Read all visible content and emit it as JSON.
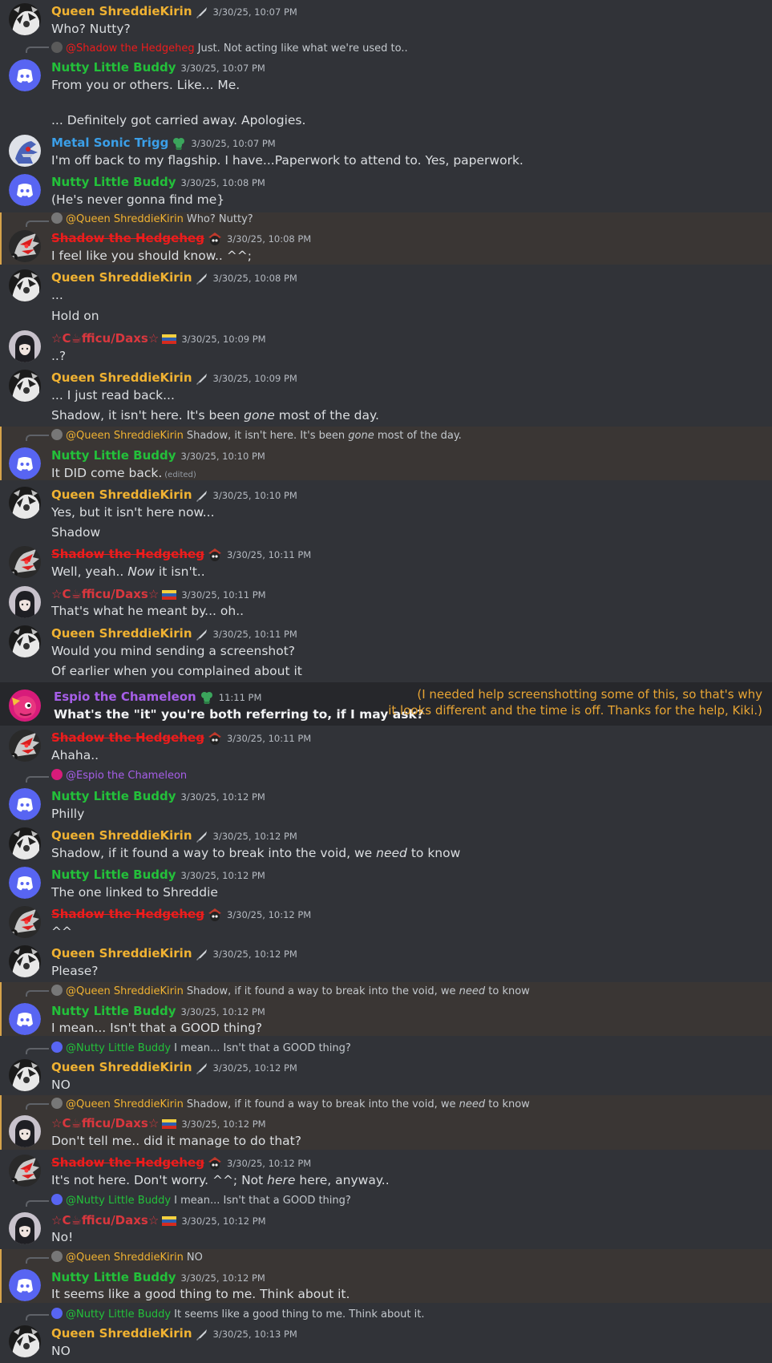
{
  "users": {
    "queen": "Queen ShreddieKirin",
    "nutty": "Nutty Little Buddy",
    "metal": "Metal Sonic Trigg",
    "shadow": "Shadow the Hedgeheg",
    "oficu": "☆C☕fficu/Daxs☆",
    "espio": "Espio the Chameleon"
  },
  "colors": {
    "queen": "#f0b232",
    "nutty": "#23c03a",
    "metal": "#3b9fe8",
    "shadow": "#ed1c1c",
    "oficu": "#d9373e",
    "espio": "#a65ee8",
    "background": "#313338",
    "highlight": "#3a3634"
  },
  "messages": {
    "m1": {
      "ts": "3/30/25, 10:07 PM",
      "lines": [
        "Who? Nutty?"
      ]
    },
    "m2": {
      "reply_to": "@Shadow the Hedgeheg",
      "reply_text": "Just. Not acting like what we're used to..",
      "ts": "3/30/25, 10:07 PM",
      "lines": [
        "From you or others. Like... Me.",
        "... Definitely got carried away. Apologies."
      ]
    },
    "m3": {
      "ts": "3/30/25, 10:07 PM",
      "lines": [
        "I'm off back to my flagship. I have...Paperwork to attend to. Yes, paperwork."
      ]
    },
    "m4": {
      "ts": "3/30/25, 10:08 PM",
      "lines": [
        "(He's never gonna find me}"
      ]
    },
    "m5": {
      "reply_to": "@Queen ShreddieKirin",
      "reply_text": "Who? Nutty?",
      "ts": "3/30/25, 10:08 PM",
      "lines": [
        "I feel like you should know.. ^^;"
      ]
    },
    "m6": {
      "ts": "3/30/25, 10:08 PM",
      "lines": [
        "...",
        "Hold on"
      ]
    },
    "m7": {
      "ts": "3/30/25, 10:09 PM",
      "lines": [
        "..?"
      ]
    },
    "m8": {
      "ts": "3/30/25, 10:09 PM",
      "line1": "... I just read back...",
      "line2_pre": "Shadow, it isn't here. It's been ",
      "line2_em": "gone",
      "line2_post": " most of the day."
    },
    "m9": {
      "reply_to": "@Queen ShreddieKirin",
      "reply_pre": "Shadow, it isn't here. It's been ",
      "reply_em": "gone",
      "reply_post": " most of the day.",
      "ts": "3/30/25, 10:10 PM",
      "lines": [
        "It DID come back."
      ],
      "edited": "(edited)"
    },
    "m10": {
      "ts": "3/30/25, 10:10 PM",
      "lines": [
        "Yes, but it isn't here now...",
        "Shadow"
      ]
    },
    "m11": {
      "ts": "3/30/25, 10:11 PM",
      "pre": "Well, yeah.. ",
      "em": "Now",
      "post": " it isn't.."
    },
    "m12": {
      "ts": "3/30/25, 10:11 PM",
      "lines": [
        "That's what he meant by... oh.."
      ]
    },
    "m13": {
      "ts": "3/30/25, 10:11 PM",
      "lines": [
        "Would you mind sending a screenshot?",
        "Of earlier when you complained about it"
      ]
    },
    "m14": {
      "ts": "11:11 PM",
      "lines": [
        "What's the \"it\" you're both referring to, if I may ask?"
      ],
      "note": [
        "(I needed help screenshotting some of this, so that's why",
        "it looks different and the time is off. Thanks for the help, Kiki.)"
      ]
    },
    "m15": {
      "ts": "3/30/25, 10:11 PM",
      "lines": [
        "Ahaha.."
      ]
    },
    "m16": {
      "reply_to": "@Espio the Chameleon",
      "ts": "3/30/25, 10:12 PM",
      "lines": [
        "Philly"
      ]
    },
    "m17": {
      "ts": "3/30/25, 10:12 PM",
      "pre": "Shadow, if it found a way to break into the void, we ",
      "em": "need",
      "post": " to know"
    },
    "m18": {
      "ts": "3/30/25, 10:12 PM",
      "lines": [
        "The one linked to Shreddie"
      ]
    },
    "m19": {
      "ts": "3/30/25, 10:12 PM",
      "lines": [
        "^^"
      ]
    },
    "m20": {
      "ts": "3/30/25, 10:12 PM",
      "lines": [
        "Please?"
      ]
    },
    "m21": {
      "reply_to": "@Queen ShreddieKirin",
      "reply_pre": "Shadow, if it found a way to break into the void, we ",
      "reply_em": "need",
      "reply_post": " to know",
      "ts": "3/30/25, 10:12 PM",
      "lines": [
        "I mean... Isn't that a GOOD thing?"
      ]
    },
    "m22": {
      "reply_to": "@Nutty Little Buddy",
      "reply_text": "I mean... Isn't that a GOOD thing?",
      "ts": "3/30/25, 10:12 PM",
      "lines": [
        "NO"
      ]
    },
    "m23": {
      "reply_to": "@Queen ShreddieKirin",
      "reply_pre": "Shadow, if it found a way to break into the void, we ",
      "reply_em": "need",
      "reply_post": " to know",
      "ts": "3/30/25, 10:12 PM",
      "lines": [
        "Don't tell me.. did it manage to do that?"
      ]
    },
    "m24": {
      "ts": "3/30/25, 10:12 PM",
      "pre": "It's not here. Don't worry. ^^; Not ",
      "em": "here",
      "post": " here, anyway.."
    },
    "m25": {
      "reply_to": "@Nutty Little Buddy",
      "reply_text": "I mean... Isn't that a GOOD thing?",
      "ts": "3/30/25, 10:12 PM",
      "lines": [
        "No!"
      ]
    },
    "m26": {
      "reply_to": "@Queen ShreddieKirin",
      "reply_text": "NO",
      "ts": "3/30/25, 10:12 PM",
      "lines": [
        "It seems like a good thing to me. Think about it."
      ]
    },
    "m27": {
      "reply_to": "@Nutty Little Buddy",
      "reply_text": "It seems like a good thing to me. Think about it.",
      "ts": "3/30/25, 10:13 PM",
      "lines": [
        "NO"
      ]
    }
  }
}
